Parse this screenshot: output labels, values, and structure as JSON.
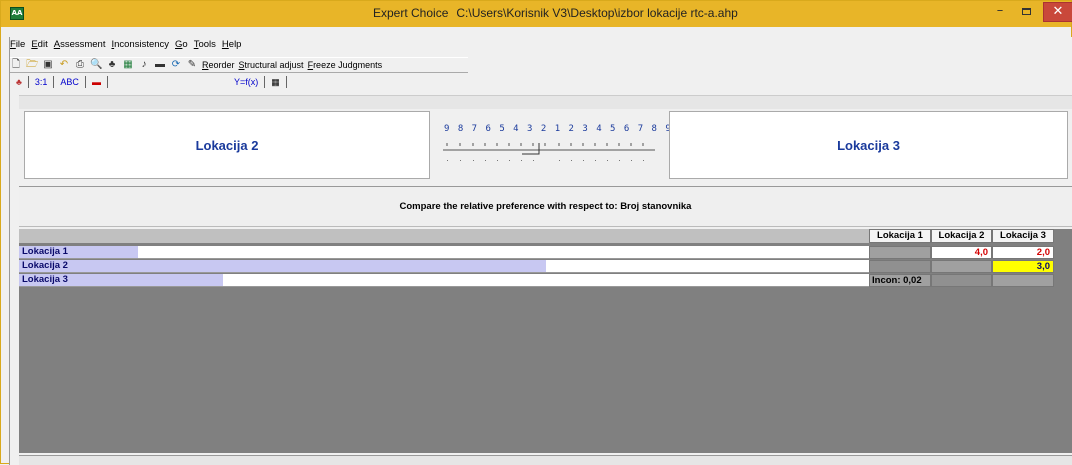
{
  "window": {
    "app_name": "Expert Choice",
    "path": "C:\\Users\\Korisnik V3\\Desktop\\izbor lokacije rtc-a.ahp",
    "icon_text": "AA",
    "min_glyph": "–",
    "close_glyph": "✕"
  },
  "menu": {
    "items": [
      "File",
      "Edit",
      "Assessment",
      "Inconsistency",
      "Go",
      "Tools",
      "Help"
    ]
  },
  "toolbar": {
    "icons": [
      "new-file-icon",
      "open-folder-icon",
      "save-icon",
      "undo-icon",
      "print-icon",
      "print-preview-icon",
      "hierarchy-icon",
      "calculator-icon",
      "music-note-icon",
      "keyboard-icon",
      "refresh-icon",
      "wand-icon"
    ],
    "reorder": "Reorder",
    "structural_adjust": "Structural adjust",
    "freeze": "Freeze Judgments"
  },
  "mode_tabs": {
    "numerical": "3:1",
    "verbal": "ABC",
    "formula": "Y=f(x)"
  },
  "comparison": {
    "left": "Lokacija 2",
    "right": "Lokacija 3",
    "scale_numbers": "9 8 7 6 5 4 3 2 1 2 3 4 5 6 7 8 9",
    "criterion_text": "Compare the relative preference  with respect to: Broj stanovnika"
  },
  "matrix": {
    "columns": [
      "Lokacija 1",
      "Lokacija 2",
      "Lokacija 3"
    ],
    "rows": [
      "Lokacija 1",
      "Lokacija 2",
      "Lokacija 3"
    ],
    "bar_fractions": [
      0.14,
      0.62,
      0.24
    ],
    "values": {
      "r1c2": "4,0",
      "r1c3": "2,0",
      "r2c3": "3,0"
    },
    "inconsistency": "Incon: 0,02"
  },
  "colors": {
    "titlebar": "#e8b528",
    "label_blue": "#1a3a9c",
    "value_red": "#d40000",
    "highlight_yellow": "#ffff00",
    "bar_lavender": "#c8c8f2"
  }
}
